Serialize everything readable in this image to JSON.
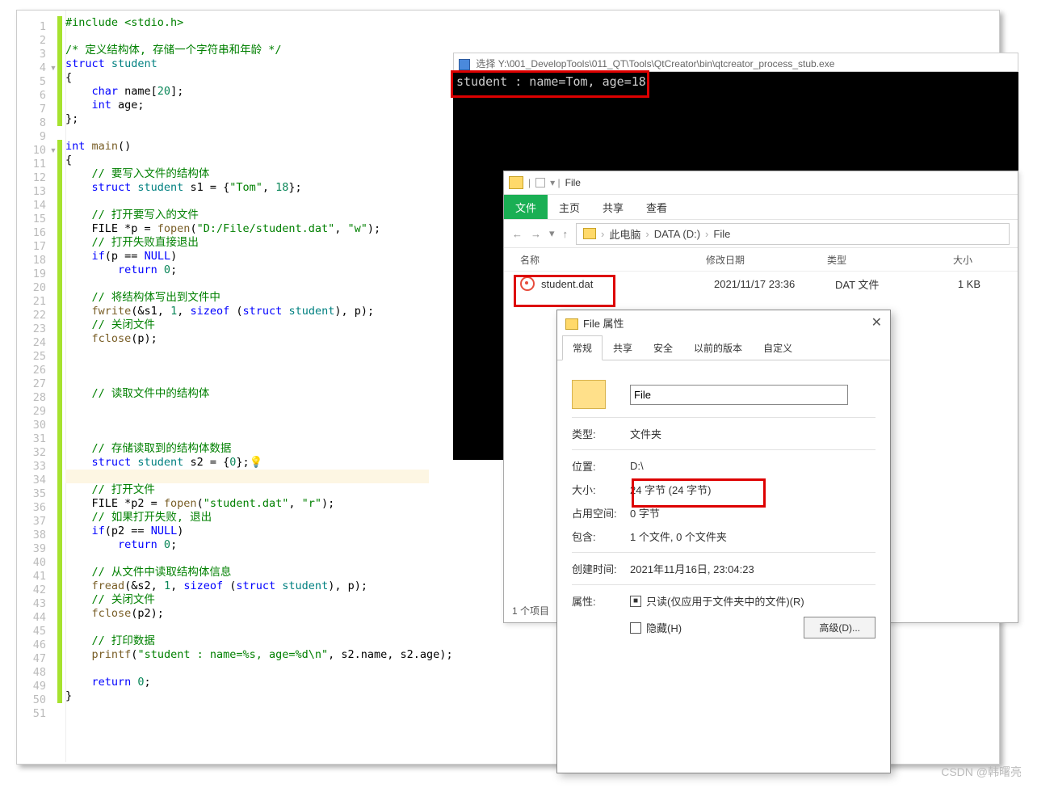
{
  "code": {
    "lines": [
      {
        "n": 1,
        "fold": "",
        "bar": 1,
        "raw": "#include <stdio.h>",
        "cls": [
          "cg-include"
        ]
      },
      {
        "n": 2,
        "fold": "",
        "bar": 1,
        "raw": ""
      },
      {
        "n": 3,
        "fold": "",
        "bar": 1,
        "raw": "/* 定义结构体, 存储一个字符串和年龄 */",
        "cls": [
          "cg-comment"
        ]
      },
      {
        "n": 4,
        "fold": "▾",
        "bar": 1,
        "tokens": [
          [
            "struct ",
            "cg-keyword"
          ],
          [
            "student",
            "cg-type"
          ]
        ]
      },
      {
        "n": 5,
        "fold": "",
        "bar": 1,
        "raw": "{"
      },
      {
        "n": 6,
        "fold": "",
        "bar": 1,
        "tokens": [
          [
            "    char ",
            "cg-keyword"
          ],
          [
            "name[",
            "cg-normal"
          ],
          [
            "20",
            "cg-num"
          ],
          [
            "];",
            "cg-normal"
          ]
        ]
      },
      {
        "n": 7,
        "fold": "",
        "bar": 1,
        "tokens": [
          [
            "    int ",
            "cg-keyword"
          ],
          [
            "age;",
            "cg-normal"
          ]
        ]
      },
      {
        "n": 8,
        "fold": "",
        "bar": 1,
        "raw": "};"
      },
      {
        "n": 9,
        "fold": "",
        "bar": 0,
        "raw": ""
      },
      {
        "n": 10,
        "fold": "▾",
        "bar": 1,
        "tokens": [
          [
            "int ",
            "cg-keyword"
          ],
          [
            "main",
            "cg-func"
          ],
          [
            "()",
            "cg-normal"
          ]
        ]
      },
      {
        "n": 11,
        "fold": "",
        "bar": 1,
        "raw": "{"
      },
      {
        "n": 12,
        "fold": "",
        "bar": 1,
        "tokens": [
          [
            "    // 要写入文件的结构体",
            "cg-comment"
          ]
        ]
      },
      {
        "n": 13,
        "fold": "",
        "bar": 1,
        "tokens": [
          [
            "    struct ",
            "cg-keyword"
          ],
          [
            "student ",
            "cg-type"
          ],
          [
            "s1 = {",
            "cg-normal"
          ],
          [
            "\"Tom\"",
            "cg-string"
          ],
          [
            ", ",
            "cg-normal"
          ],
          [
            "18",
            "cg-num"
          ],
          [
            "};",
            "cg-normal"
          ]
        ]
      },
      {
        "n": 14,
        "fold": "",
        "bar": 1,
        "raw": ""
      },
      {
        "n": 15,
        "fold": "",
        "bar": 1,
        "tokens": [
          [
            "    // 打开要写入的文件",
            "cg-comment"
          ]
        ]
      },
      {
        "n": 16,
        "fold": "",
        "bar": 1,
        "tokens": [
          [
            "    FILE *p = ",
            "cg-normal"
          ],
          [
            "fopen",
            "cg-func"
          ],
          [
            "(",
            "cg-normal"
          ],
          [
            "\"D:/File/student.dat\"",
            "cg-string"
          ],
          [
            ", ",
            "cg-normal"
          ],
          [
            "\"w\"",
            "cg-string"
          ],
          [
            ");",
            "cg-normal"
          ]
        ]
      },
      {
        "n": 17,
        "fold": "",
        "bar": 1,
        "tokens": [
          [
            "    // 打开失败直接退出",
            "cg-comment"
          ]
        ]
      },
      {
        "n": 18,
        "fold": "",
        "bar": 1,
        "tokens": [
          [
            "    if",
            "cg-keyword"
          ],
          [
            "(p == ",
            "cg-normal"
          ],
          [
            "NULL",
            "cg-keyword"
          ],
          [
            ")",
            "cg-normal"
          ]
        ]
      },
      {
        "n": 19,
        "fold": "",
        "bar": 1,
        "tokens": [
          [
            "        return ",
            "cg-keyword"
          ],
          [
            "0",
            "cg-num"
          ],
          [
            ";",
            "cg-normal"
          ]
        ]
      },
      {
        "n": 20,
        "fold": "",
        "bar": 1,
        "raw": ""
      },
      {
        "n": 21,
        "fold": "",
        "bar": 1,
        "tokens": [
          [
            "    // 将结构体写出到文件中",
            "cg-comment"
          ]
        ]
      },
      {
        "n": 22,
        "fold": "",
        "bar": 1,
        "tokens": [
          [
            "    ",
            "cg-normal"
          ],
          [
            "fwrite",
            "cg-func"
          ],
          [
            "(&s1, ",
            "cg-normal"
          ],
          [
            "1",
            "cg-num"
          ],
          [
            ", ",
            "cg-normal"
          ],
          [
            "sizeof ",
            "cg-keyword"
          ],
          [
            "(",
            "cg-normal"
          ],
          [
            "struct ",
            "cg-keyword"
          ],
          [
            "student",
            "cg-type"
          ],
          [
            "), p);",
            "cg-normal"
          ]
        ]
      },
      {
        "n": 23,
        "fold": "",
        "bar": 1,
        "tokens": [
          [
            "    // 关闭文件",
            "cg-comment"
          ]
        ]
      },
      {
        "n": 24,
        "fold": "",
        "bar": 1,
        "tokens": [
          [
            "    ",
            "cg-normal"
          ],
          [
            "fclose",
            "cg-func"
          ],
          [
            "(p);",
            "cg-normal"
          ]
        ]
      },
      {
        "n": 25,
        "fold": "",
        "bar": 1,
        "raw": ""
      },
      {
        "n": 26,
        "fold": "",
        "bar": 1,
        "raw": ""
      },
      {
        "n": 27,
        "fold": "",
        "bar": 1,
        "raw": ""
      },
      {
        "n": 28,
        "fold": "",
        "bar": 1,
        "tokens": [
          [
            "    // 读取文件中的结构体",
            "cg-comment"
          ]
        ]
      },
      {
        "n": 29,
        "fold": "",
        "bar": 1,
        "raw": ""
      },
      {
        "n": 30,
        "fold": "",
        "bar": 1,
        "raw": ""
      },
      {
        "n": 31,
        "fold": "",
        "bar": 1,
        "raw": ""
      },
      {
        "n": 32,
        "fold": "",
        "bar": 1,
        "tokens": [
          [
            "    // 存储读取到的结构体数据",
            "cg-comment"
          ]
        ]
      },
      {
        "n": 33,
        "fold": "",
        "bar": 1,
        "tokens": [
          [
            "    struct ",
            "cg-keyword"
          ],
          [
            "student ",
            "cg-type"
          ],
          [
            "s2 = {",
            "cg-normal"
          ],
          [
            "0",
            "cg-num"
          ],
          [
            "};",
            "cg-normal"
          ],
          [
            "💡",
            "bulb"
          ]
        ]
      },
      {
        "n": 34,
        "fold": "",
        "bar": 1,
        "raw": "",
        "hl": 1
      },
      {
        "n": 35,
        "fold": "",
        "bar": 1,
        "tokens": [
          [
            "    // 打开文件",
            "cg-comment"
          ]
        ]
      },
      {
        "n": 36,
        "fold": "",
        "bar": 1,
        "tokens": [
          [
            "    FILE *p2 = ",
            "cg-normal"
          ],
          [
            "fopen",
            "cg-func"
          ],
          [
            "(",
            "cg-normal"
          ],
          [
            "\"student.dat\"",
            "cg-string"
          ],
          [
            ", ",
            "cg-normal"
          ],
          [
            "\"r\"",
            "cg-string"
          ],
          [
            ");",
            "cg-normal"
          ]
        ]
      },
      {
        "n": 37,
        "fold": "",
        "bar": 1,
        "tokens": [
          [
            "    // 如果打开失败, 退出",
            "cg-comment"
          ]
        ]
      },
      {
        "n": 38,
        "fold": "",
        "bar": 1,
        "tokens": [
          [
            "    if",
            "cg-keyword"
          ],
          [
            "(p2 == ",
            "cg-normal"
          ],
          [
            "NULL",
            "cg-keyword"
          ],
          [
            ")",
            "cg-normal"
          ]
        ]
      },
      {
        "n": 39,
        "fold": "",
        "bar": 1,
        "tokens": [
          [
            "        return ",
            "cg-keyword"
          ],
          [
            "0",
            "cg-num"
          ],
          [
            ";",
            "cg-normal"
          ]
        ]
      },
      {
        "n": 40,
        "fold": "",
        "bar": 1,
        "raw": ""
      },
      {
        "n": 41,
        "fold": "",
        "bar": 1,
        "tokens": [
          [
            "    // 从文件中读取结构体信息",
            "cg-comment"
          ]
        ]
      },
      {
        "n": 42,
        "fold": "",
        "bar": 1,
        "tokens": [
          [
            "    ",
            "cg-normal"
          ],
          [
            "fread",
            "cg-func"
          ],
          [
            "(&s2, ",
            "cg-normal"
          ],
          [
            "1",
            "cg-num"
          ],
          [
            ", ",
            "cg-normal"
          ],
          [
            "sizeof ",
            "cg-keyword"
          ],
          [
            "(",
            "cg-normal"
          ],
          [
            "struct ",
            "cg-keyword"
          ],
          [
            "student",
            "cg-type"
          ],
          [
            "), p);",
            "cg-normal"
          ]
        ]
      },
      {
        "n": 43,
        "fold": "",
        "bar": 1,
        "tokens": [
          [
            "    // 关闭文件",
            "cg-comment"
          ]
        ]
      },
      {
        "n": 44,
        "fold": "",
        "bar": 1,
        "tokens": [
          [
            "    ",
            "cg-normal"
          ],
          [
            "fclose",
            "cg-func"
          ],
          [
            "(p2);",
            "cg-normal"
          ]
        ]
      },
      {
        "n": 45,
        "fold": "",
        "bar": 1,
        "raw": ""
      },
      {
        "n": 46,
        "fold": "",
        "bar": 1,
        "tokens": [
          [
            "    // 打印数据",
            "cg-comment"
          ]
        ]
      },
      {
        "n": 47,
        "fold": "",
        "bar": 1,
        "tokens": [
          [
            "    ",
            "cg-normal"
          ],
          [
            "printf",
            "cg-func"
          ],
          [
            "(",
            "cg-normal"
          ],
          [
            "\"student : name=%s, age=%d\\n\"",
            "cg-string"
          ],
          [
            ", s2.name, s2.age);",
            "cg-normal"
          ]
        ]
      },
      {
        "n": 48,
        "fold": "",
        "bar": 1,
        "raw": ""
      },
      {
        "n": 49,
        "fold": "",
        "bar": 1,
        "tokens": [
          [
            "    return ",
            "cg-keyword"
          ],
          [
            "0",
            "cg-num"
          ],
          [
            ";",
            "cg-normal"
          ]
        ]
      },
      {
        "n": 50,
        "fold": "",
        "bar": 1,
        "raw": "}"
      },
      {
        "n": 51,
        "fold": "",
        "bar": 0,
        "raw": ""
      }
    ]
  },
  "console": {
    "title_prefix": "选择",
    "title": "Y:\\001_DevelopTools\\011_QT\\Tools\\QtCreator\\bin\\qtcreator_process_stub.exe",
    "output": "student : name=Tom, age=18"
  },
  "explorer": {
    "window_title": "File",
    "tabs": [
      "文件",
      "主页",
      "共享",
      "查看"
    ],
    "nav": {
      "back": "←",
      "fwd": "→",
      "up": "↑"
    },
    "breadcrumbs": [
      "此电脑",
      "DATA (D:)",
      "File"
    ],
    "headers": {
      "name": "名称",
      "date": "修改日期",
      "type": "类型",
      "size": "大小"
    },
    "row": {
      "name": "student.dat",
      "date": "2021/11/17 23:36",
      "type": "DAT 文件",
      "size": "1 KB"
    },
    "footer": "1 个项目"
  },
  "properties": {
    "title": "File 属性",
    "tabs": [
      "常规",
      "共享",
      "安全",
      "以前的版本",
      "自定义"
    ],
    "filename": "File",
    "rows": {
      "type_label": "类型:",
      "type_value": "文件夹",
      "loc_label": "位置:",
      "loc_value": "D:\\",
      "size_label": "大小:",
      "size_value": "24 字节 (24 字节)",
      "disk_label": "占用空间:",
      "disk_value": "0 字节",
      "contain_label": "包含:",
      "contain_value": "1 个文件, 0 个文件夹",
      "created_label": "创建时间:",
      "created_value": "2021年11月16日, 23:04:23",
      "attr_label": "属性:",
      "readonly_label": "只读(仅应用于文件夹中的文件)(R)",
      "hidden_label": "隐藏(H)",
      "advanced_btn": "高级(D)..."
    }
  },
  "watermark": "CSDN @韩曙亮"
}
